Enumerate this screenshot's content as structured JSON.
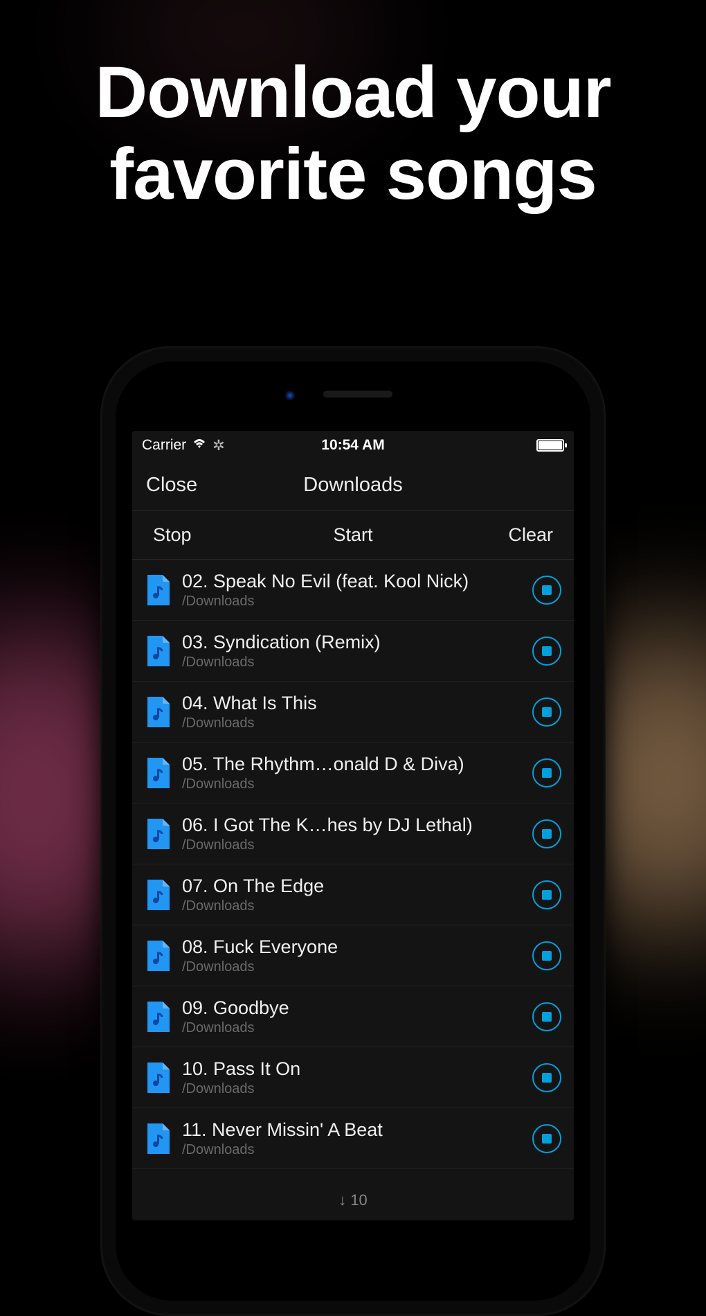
{
  "marketing": {
    "headline_line1": "Download your",
    "headline_line2": "favorite songs"
  },
  "statusbar": {
    "carrier": "Carrier",
    "time": "10:54 AM"
  },
  "navbar": {
    "close": "Close",
    "title": "Downloads"
  },
  "toolbar": {
    "stop": "Stop",
    "start": "Start",
    "clear": "Clear"
  },
  "list": {
    "items": [
      {
        "title": "02. Speak No Evil (feat. Kool Nick)",
        "path": "/Downloads"
      },
      {
        "title": "03. Syndication (Remix)",
        "path": "/Downloads"
      },
      {
        "title": "04. What Is This",
        "path": "/Downloads"
      },
      {
        "title": "05. The Rhythm…onald D & Diva)",
        "path": "/Downloads"
      },
      {
        "title": "06. I Got The K…hes by DJ Lethal)",
        "path": "/Downloads"
      },
      {
        "title": "07. On The Edge",
        "path": "/Downloads"
      },
      {
        "title": "08. Fuck Everyone",
        "path": "/Downloads"
      },
      {
        "title": "09. Goodbye",
        "path": "/Downloads"
      },
      {
        "title": "10. Pass It On",
        "path": "/Downloads"
      },
      {
        "title": "11. Never Missin' A Beat",
        "path": "/Downloads"
      }
    ]
  },
  "footer": {
    "count_text": "↓ 10"
  }
}
